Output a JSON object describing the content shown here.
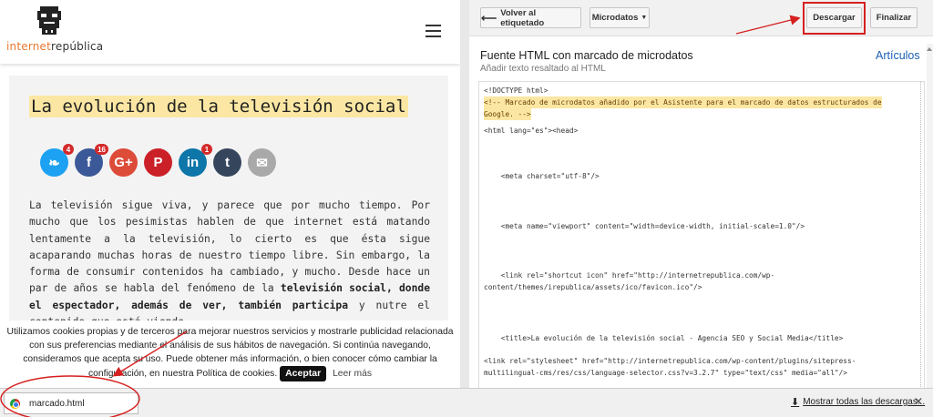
{
  "site": {
    "logo_text_a": "internet",
    "logo_text_b": "república",
    "article_title": "La evolución de la televisión social",
    "social": [
      {
        "icon": "twitter-icon",
        "glyph": "❧",
        "color": "#1da1f2",
        "count": "4"
      },
      {
        "icon": "facebook-icon",
        "glyph": "f",
        "color": "#3b5998",
        "count": "16"
      },
      {
        "icon": "google-plus-icon",
        "glyph": "G+",
        "color": "#dd4b39",
        "count": ""
      },
      {
        "icon": "pinterest-icon",
        "glyph": "P",
        "color": "#cb2027",
        "count": ""
      },
      {
        "icon": "linkedin-icon",
        "glyph": "in",
        "color": "#0e76a8",
        "count": "1"
      },
      {
        "icon": "tumblr-icon",
        "glyph": "t",
        "color": "#35465c",
        "count": ""
      },
      {
        "icon": "email-icon",
        "glyph": "✉",
        "color": "#a9a9a9",
        "count": ""
      }
    ],
    "para_1": "La televisión sigue viva, y parece que por mucho tiempo. Por mucho que los pesimistas hablen de que internet está matando lentamente a la televisión, lo cierto es que ésta sigue acaparando muchas horas de nuestro tiempo libre. Sin embargo, la forma de consumir contenidos ha cambiado, y mucho. Desde hace un par de años se habla del fenómeno de la ",
    "para_bold": "televisión social, donde el espectador, además de ver, también participa",
    "para_2": " y nutre el contenido que está viendo.",
    "cookie_text": "Utilizamos cookies propias y de terceros para mejorar nuestros servicios y mostrarle publicidad relacionada con sus preferencias mediante el análisis de sus hábitos de navegación. Si continúa navegando, consideramos que acepta su uso. Puede obtener más información, o bien conocer cómo cambiar la configuración, en nuestra Política de cookies.",
    "accept_label": "Aceptar",
    "more_label": "Leer más"
  },
  "tool": {
    "back_label": "Volver al etiquetado",
    "microdata_label": "Microdatos",
    "download_label": "Descargar",
    "finish_label": "Finalizar",
    "panel_title": "Fuente HTML con marcado de microdatos",
    "panel_sub": "Añadir texto resaltado al HTML",
    "articles_link": "Artículos",
    "code_lines": [
      {
        "text": "<!DOCTYPE html>",
        "hl": false
      },
      {
        "text": "<!-- Marcado de microdatos añadido por el Asistente para el marcado de datos estructurados de",
        "hl": true
      },
      {
        "text": "Google. -->",
        "hl": true
      },
      {
        "text": "<html lang=\"es\"><head>",
        "hl": false
      },
      {
        "text": "    <meta charset=\"utf-8\"/>",
        "hl": false
      },
      {
        "text": "    <meta name=\"viewport\" content=\"width=device-width, initial-scale=1.0\"/>",
        "hl": false
      },
      {
        "text": "    <link rel=\"shortcut icon\" href=\"http://internetrepublica.com/wp-",
        "hl": false
      },
      {
        "text": "content/themes/irepublica/assets/ico/favicon.ico\"/>",
        "hl": false
      },
      {
        "text": "    <title>La evolución de la televisión social - Agencia SEO y Social Media</title>",
        "hl": false
      },
      {
        "text": "<link rel=\"stylesheet\" href=\"http://internetrepublica.com/wp-content/plugins/sitepress-",
        "hl": false
      },
      {
        "text": "multilingual-cms/res/css/language-selector.css?v=3.2.7\" type=\"text/css\" media=\"all\"/>",
        "hl": false
      }
    ]
  },
  "downloads": {
    "file_name": "marcado.html",
    "show_all": "Mostrar todas las descargas...",
    "close_glyph": "✕"
  },
  "colors": {
    "annotation": "#d61f1f",
    "link": "#1a5fb4",
    "highlight": "#fbe7a3"
  }
}
